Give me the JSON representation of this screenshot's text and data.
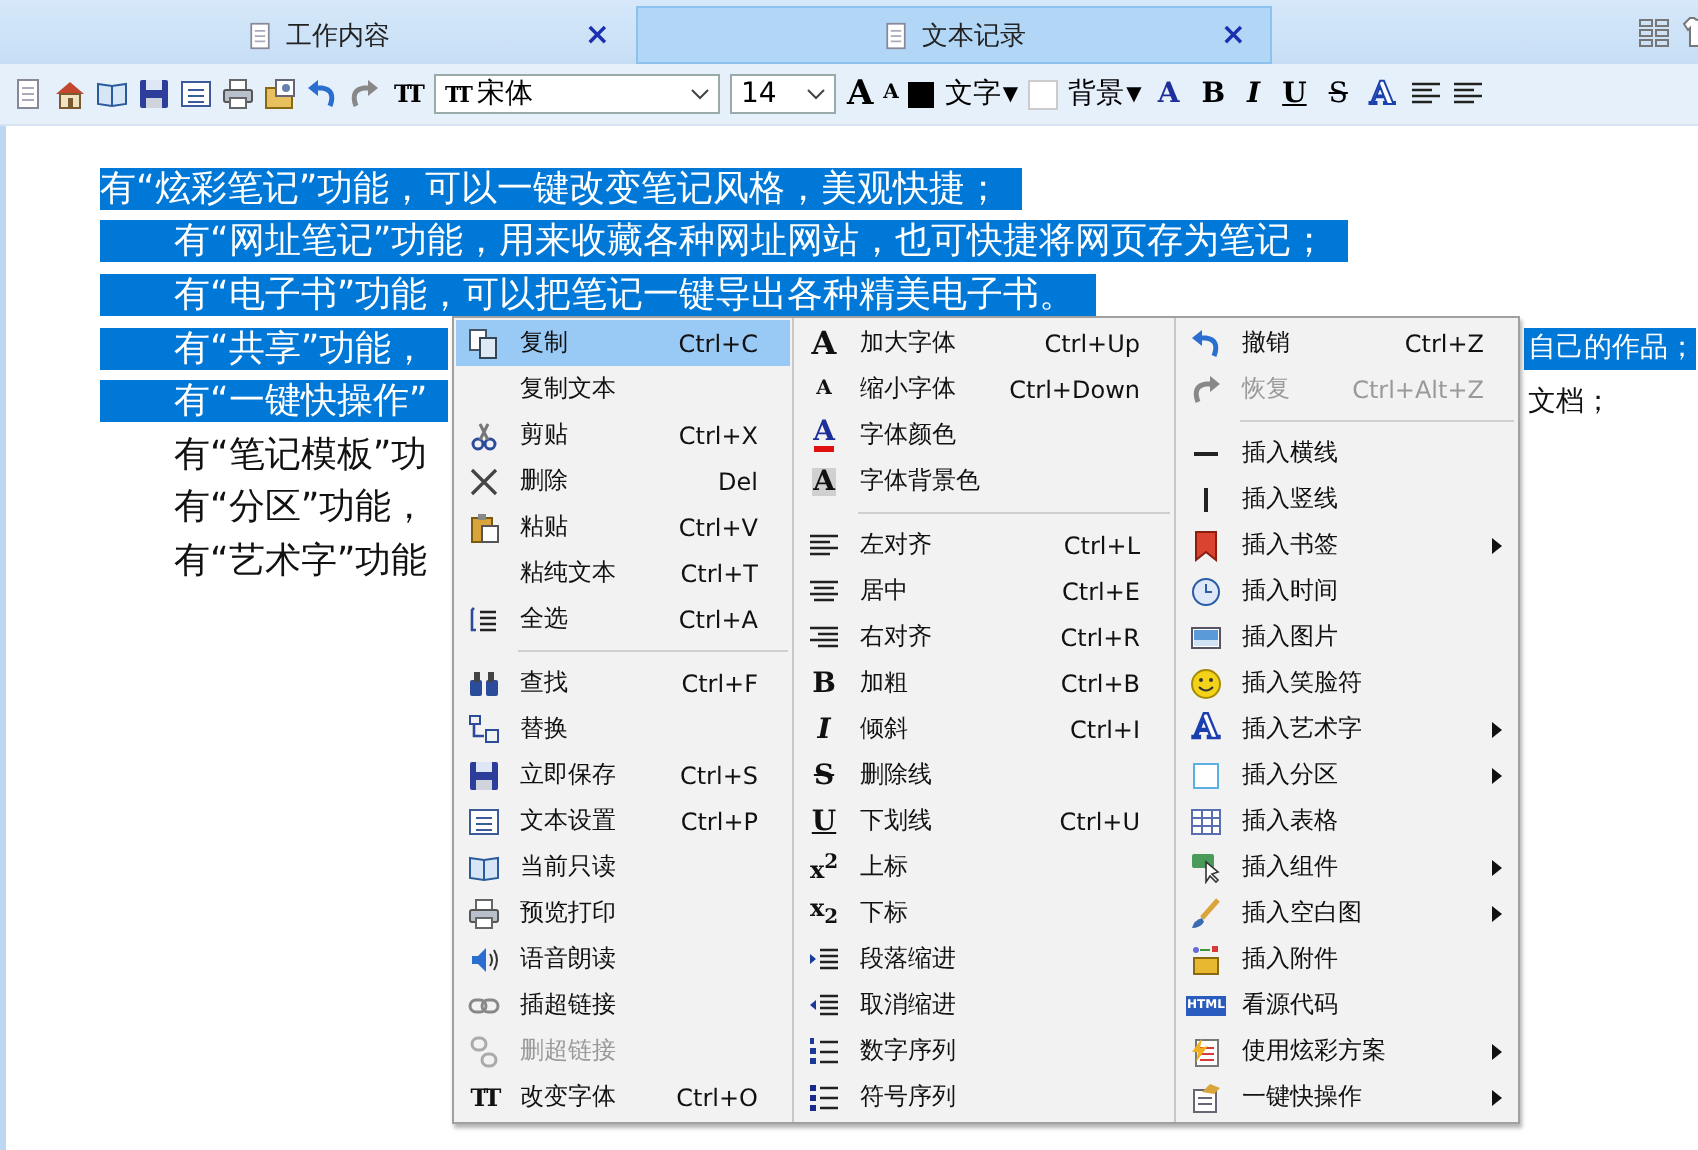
{
  "tabs": [
    {
      "label": "工作内容",
      "selected": false,
      "close": "×"
    },
    {
      "label": "文本记录",
      "selected": true,
      "close": "×"
    }
  ],
  "toolbar": {
    "font_glyph": "TT",
    "font_select": {
      "glyph": "TT",
      "value": "宋体"
    },
    "size_select": {
      "value": "14"
    },
    "size_glyphs": [
      "A",
      "A"
    ],
    "text_color": {
      "label": "文字",
      "arrow": "▼"
    },
    "background": {
      "label": "背景",
      "arrow": "▼"
    },
    "format_glyphs": [
      "A",
      "B",
      "I",
      "U",
      "S",
      "A"
    ]
  },
  "document": {
    "lines": [
      {
        "text": "有“炫彩笔记”功能，可以一键改变笔记风格，美观快捷；",
        "indented": false,
        "selected": true
      },
      {
        "text": "有“网址笔记”功能，用来收藏各种网址网站，也可快捷将网页存为笔记；",
        "indented": true,
        "selected": true
      },
      {
        "text": "有“电子书”功能，可以把笔记一键导出各种精美电子书。",
        "indented": true,
        "selected": true
      },
      {
        "text": "有“共享”功能，",
        "indented": true,
        "selected": true,
        "tail": "自己的作品；",
        "tail_selected": true
      },
      {
        "text": "有“一键快操作”",
        "indented": true,
        "selected": true,
        "tail": "文档；",
        "tail_selected": false
      },
      {
        "text": "有“笔记模板”功",
        "indented": true,
        "selected": false
      },
      {
        "text": "有“分区”功能，",
        "indented": true,
        "selected": false
      },
      {
        "text": "有“艺术字”功能",
        "indented": true,
        "selected": false
      }
    ]
  },
  "context_menu": {
    "columns": [
      [
        {
          "kind": "item",
          "label": "复制",
          "shortcut": "Ctrl+C",
          "selected": true,
          "disabled": false,
          "submenu": false
        },
        {
          "kind": "item",
          "label": "复制文本",
          "selected": false,
          "disabled": false,
          "submenu": false
        },
        {
          "kind": "item",
          "label": "剪贴",
          "shortcut": "Ctrl+X",
          "selected": false,
          "disabled": false,
          "submenu": false
        },
        {
          "kind": "item",
          "label": "删除",
          "shortcut": "Del",
          "selected": false,
          "disabled": false,
          "submenu": false
        },
        {
          "kind": "item",
          "label": "粘贴",
          "shortcut": "Ctrl+V",
          "selected": false,
          "disabled": false,
          "submenu": false
        },
        {
          "kind": "item",
          "label": "粘纯文本",
          "shortcut": "Ctrl+T",
          "selected": false,
          "disabled": false,
          "submenu": false
        },
        {
          "kind": "item",
          "label": "全选",
          "shortcut": "Ctrl+A",
          "selected": false,
          "disabled": false,
          "submenu": false
        },
        {
          "kind": "separator"
        },
        {
          "kind": "item",
          "label": "查找",
          "shortcut": "Ctrl+F",
          "selected": false,
          "disabled": false,
          "submenu": false
        },
        {
          "kind": "item",
          "label": "替换",
          "selected": false,
          "disabled": false,
          "submenu": false
        },
        {
          "kind": "item",
          "label": "立即保存",
          "shortcut": "Ctrl+S",
          "selected": false,
          "disabled": false,
          "submenu": false
        },
        {
          "kind": "item",
          "label": "文本设置",
          "shortcut": "Ctrl+P",
          "selected": false,
          "disabled": false,
          "submenu": false
        },
        {
          "kind": "item",
          "label": "当前只读",
          "selected": false,
          "disabled": false,
          "submenu": false
        },
        {
          "kind": "item",
          "label": "预览打印",
          "selected": false,
          "disabled": false,
          "submenu": false
        },
        {
          "kind": "item",
          "label": "语音朗读",
          "selected": false,
          "disabled": false,
          "submenu": false
        },
        {
          "kind": "item",
          "label": "插超链接",
          "selected": false,
          "disabled": false,
          "submenu": false
        },
        {
          "kind": "item",
          "label": "删超链接",
          "selected": false,
          "disabled": true,
          "submenu": false
        },
        {
          "kind": "item",
          "label": "改变字体",
          "shortcut": "Ctrl+O",
          "glyph": "TT",
          "selected": false,
          "disabled": false,
          "submenu": false
        }
      ],
      [
        {
          "kind": "item",
          "label": "加大字体",
          "shortcut": "Ctrl+Up",
          "glyph": "A",
          "selected": false,
          "disabled": false,
          "submenu": false
        },
        {
          "kind": "item",
          "label": "缩小字体",
          "shortcut": "Ctrl+Down",
          "glyph": "A",
          "selected": false,
          "disabled": false,
          "submenu": false
        },
        {
          "kind": "item",
          "label": "字体颜色",
          "glyph": "A",
          "selected": false,
          "disabled": false,
          "submenu": false
        },
        {
          "kind": "item",
          "label": "字体背景色",
          "glyph": "A",
          "selected": false,
          "disabled": false,
          "submenu": false
        },
        {
          "kind": "separator"
        },
        {
          "kind": "item",
          "label": "左对齐",
          "shortcut": "Ctrl+L",
          "selected": false,
          "disabled": false,
          "submenu": false
        },
        {
          "kind": "item",
          "label": "居中",
          "shortcut": "Ctrl+E",
          "selected": false,
          "disabled": false,
          "submenu": false
        },
        {
          "kind": "item",
          "label": "右对齐",
          "shortcut": "Ctrl+R",
          "selected": false,
          "disabled": false,
          "submenu": false
        },
        {
          "kind": "item",
          "label": "加粗",
          "shortcut": "Ctrl+B",
          "glyph": "B",
          "selected": false,
          "disabled": false,
          "submenu": false
        },
        {
          "kind": "item",
          "label": "倾斜",
          "shortcut": "Ctrl+I",
          "glyph": "I",
          "selected": false,
          "disabled": false,
          "submenu": false
        },
        {
          "kind": "item",
          "label": "删除线",
          "glyph": "S",
          "selected": false,
          "disabled": false,
          "submenu": false
        },
        {
          "kind": "item",
          "label": "下划线",
          "shortcut": "Ctrl+U",
          "glyph": "U",
          "selected": false,
          "disabled": false,
          "submenu": false
        },
        {
          "kind": "item",
          "label": "上标",
          "glyph": "x$^{2}$",
          "selected": false,
          "disabled": false,
          "submenu": false
        },
        {
          "kind": "item",
          "label": "下标",
          "glyph": "x$_{2}$",
          "selected": false,
          "disabled": false,
          "submenu": false
        },
        {
          "kind": "item",
          "label": "段落缩进",
          "selected": false,
          "disabled": false,
          "submenu": false
        },
        {
          "kind": "item",
          "label": "取消缩进",
          "selected": false,
          "disabled": false,
          "submenu": false
        },
        {
          "kind": "item",
          "label": "数字序列",
          "selected": false,
          "disabled": false,
          "submenu": false
        },
        {
          "kind": "item",
          "label": "符号序列",
          "selected": false,
          "disabled": false,
          "submenu": false
        }
      ],
      [
        {
          "kind": "item",
          "label": "撤销",
          "shortcut": "Ctrl+Z",
          "selected": false,
          "disabled": false,
          "submenu": false
        },
        {
          "kind": "item",
          "label": "恢复",
          "shortcut": "Ctrl+Alt+Z",
          "selected": false,
          "disabled": true,
          "submenu": false
        },
        {
          "kind": "separator"
        },
        {
          "kind": "item",
          "label": "插入横线",
          "selected": false,
          "disabled": false,
          "submenu": false
        },
        {
          "kind": "item",
          "label": "插入竖线",
          "selected": false,
          "disabled": false,
          "submenu": false
        },
        {
          "kind": "item",
          "label": "插入书签",
          "selected": false,
          "disabled": false,
          "submenu": true
        },
        {
          "kind": "item",
          "label": "插入时间",
          "selected": false,
          "disabled": false,
          "submenu": false
        },
        {
          "kind": "item",
          "label": "插入图片",
          "selected": false,
          "disabled": false,
          "submenu": false
        },
        {
          "kind": "item",
          "label": "插入笑脸符",
          "selected": false,
          "disabled": false,
          "submenu": false
        },
        {
          "kind": "item",
          "label": "插入艺术字",
          "glyph": "A",
          "selected": false,
          "disabled": false,
          "submenu": true
        },
        {
          "kind": "item",
          "label": "插入分区",
          "selected": false,
          "disabled": false,
          "submenu": true
        },
        {
          "kind": "item",
          "label": "插入表格",
          "selected": false,
          "disabled": false,
          "submenu": false
        },
        {
          "kind": "item",
          "label": "插入组件",
          "selected": false,
          "disabled": false,
          "submenu": true
        },
        {
          "kind": "item",
          "label": "插入空白图",
          "selected": false,
          "disabled": false,
          "submenu": true
        },
        {
          "kind": "item",
          "label": "插入附件",
          "selected": false,
          "disabled": false,
          "submenu": false
        },
        {
          "kind": "item",
          "label": "看源代码",
          "glyph": "HTML",
          "selected": false,
          "disabled": false,
          "submenu": false
        },
        {
          "kind": "item",
          "label": "使用炫彩方案",
          "selected": false,
          "disabled": false,
          "submenu": true
        },
        {
          "kind": "item",
          "label": "一键快操作",
          "selected": false,
          "disabled": false,
          "submenu": true
        }
      ]
    ]
  }
}
